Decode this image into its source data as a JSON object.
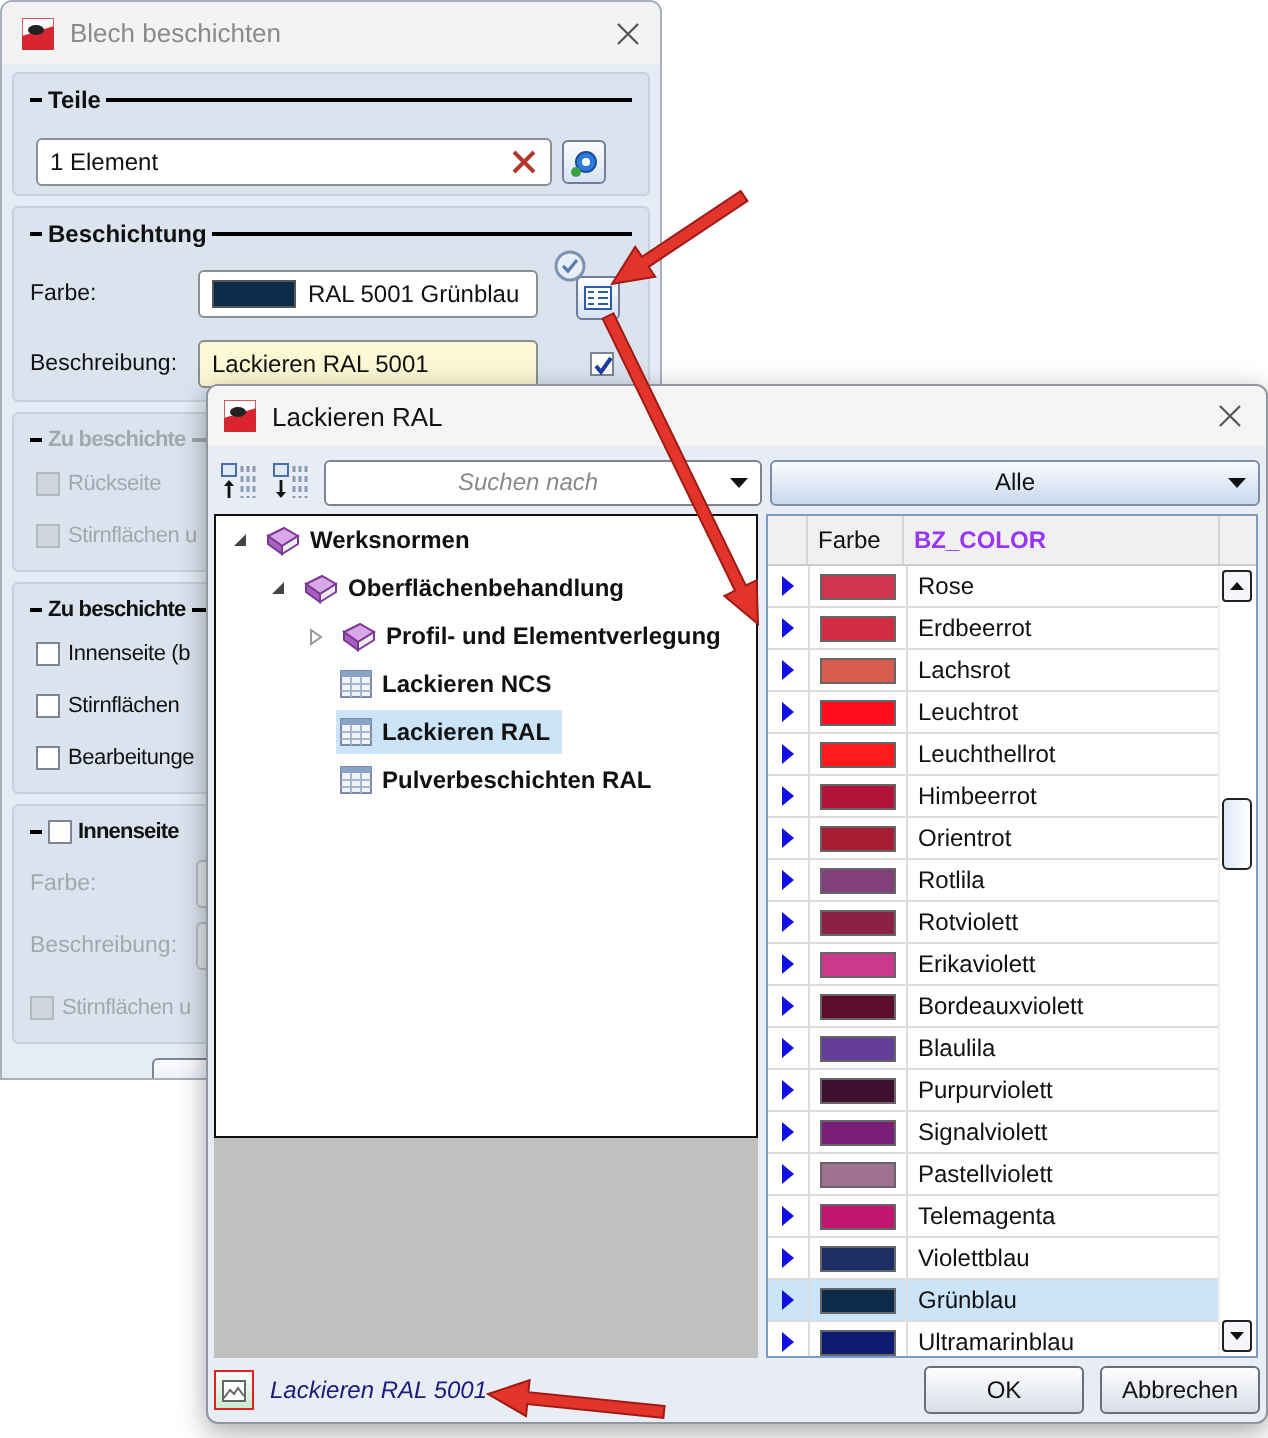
{
  "back_window": {
    "title": "Blech beschichten",
    "parts": {
      "heading": "Teile",
      "value": "1 Element"
    },
    "coating": {
      "heading": "Beschichtung",
      "color_label": "Farbe:",
      "color_value": "RAL 5001 Grünblau",
      "color": "#0c2d4a",
      "description_label": "Beschreibung:",
      "description_value": "Lackieren RAL 5001",
      "description_checked": true
    },
    "faces": {
      "heading": "Zu beschichte",
      "disabled": true,
      "options": [
        {
          "label": "Rückseite",
          "checked": false
        },
        {
          "label": "Stirnflächen u",
          "checked": false
        }
      ]
    },
    "faces_2": {
      "heading": "Zu beschichte",
      "disabled": false,
      "options": [
        {
          "label": "Innenseite (b",
          "checked": false
        },
        {
          "label": "Stirnflächen",
          "checked": false
        },
        {
          "label": "Bearbeitunge",
          "checked": false
        }
      ]
    },
    "inner": {
      "heading": "Innenseite",
      "checked": false,
      "disabled": true,
      "color_label": "Farbe:",
      "description_label": "Beschreibung:",
      "option": {
        "label": "Stirnflächen u",
        "checked": false
      }
    }
  },
  "picker": {
    "title": "Lackieren RAL",
    "search_placeholder": "Suchen nach",
    "filter": "Alle",
    "tree": [
      {
        "label": "Werksnormen",
        "kind": "book",
        "expanded": true,
        "selected": false,
        "children": [
          {
            "label": "Oberflächenbehandlung",
            "kind": "book",
            "expanded": true,
            "selected": false,
            "children": [
              {
                "label": "Profil- und Elementverlegung",
                "kind": "book",
                "expanded": false,
                "selected": false
              },
              {
                "label": "Lackieren NCS",
                "kind": "table",
                "selected": false
              },
              {
                "label": "Lackieren RAL",
                "kind": "table",
                "selected": true
              },
              {
                "label": "Pulverbeschichten RAL",
                "kind": "table",
                "selected": false
              }
            ]
          }
        ]
      }
    ],
    "columns": [
      "Farbe",
      "BZ_COLOR"
    ],
    "rows": [
      {
        "name": "Rose",
        "color": "#d1344f",
        "selected": false
      },
      {
        "name": "Erdbeerrot",
        "color": "#d12c42",
        "selected": false
      },
      {
        "name": "Lachsrot",
        "color": "#d65c4e",
        "selected": false
      },
      {
        "name": "Leuchtrot",
        "color": "#ff0c1d",
        "selected": false
      },
      {
        "name": "Leuchthellrot",
        "color": "#ff1a1c",
        "selected": false
      },
      {
        "name": "Himbeerrot",
        "color": "#b3123a",
        "selected": false
      },
      {
        "name": "Orientrot",
        "color": "#a71c32",
        "selected": false
      },
      {
        "name": "Rotlila",
        "color": "#813f7c",
        "selected": false
      },
      {
        "name": "Rotviolett",
        "color": "#8b2143",
        "selected": false
      },
      {
        "name": "Erikaviolett",
        "color": "#c93a8c",
        "selected": false
      },
      {
        "name": "Bordeauxviolett",
        "color": "#5c0d2b",
        "selected": false
      },
      {
        "name": "Blaulila",
        "color": "#653e9b",
        "selected": false
      },
      {
        "name": "Purpurviolett",
        "color": "#3e0f2e",
        "selected": false
      },
      {
        "name": "Signalviolett",
        "color": "#7c1e79",
        "selected": false
      },
      {
        "name": "Pastellviolett",
        "color": "#a0718e",
        "selected": false
      },
      {
        "name": "Telemagenta",
        "color": "#c3146f",
        "selected": false
      },
      {
        "name": "Violettblau",
        "color": "#1c2e63",
        "selected": false
      },
      {
        "name": "Grünblau",
        "color": "#0c2d4a",
        "selected": true
      },
      {
        "name": "Ultramarinblau",
        "color": "#0c1a6f",
        "selected": false
      }
    ],
    "selection_text": "Lackieren RAL 5001",
    "buttons": [
      "OK",
      "Abbrechen"
    ]
  }
}
